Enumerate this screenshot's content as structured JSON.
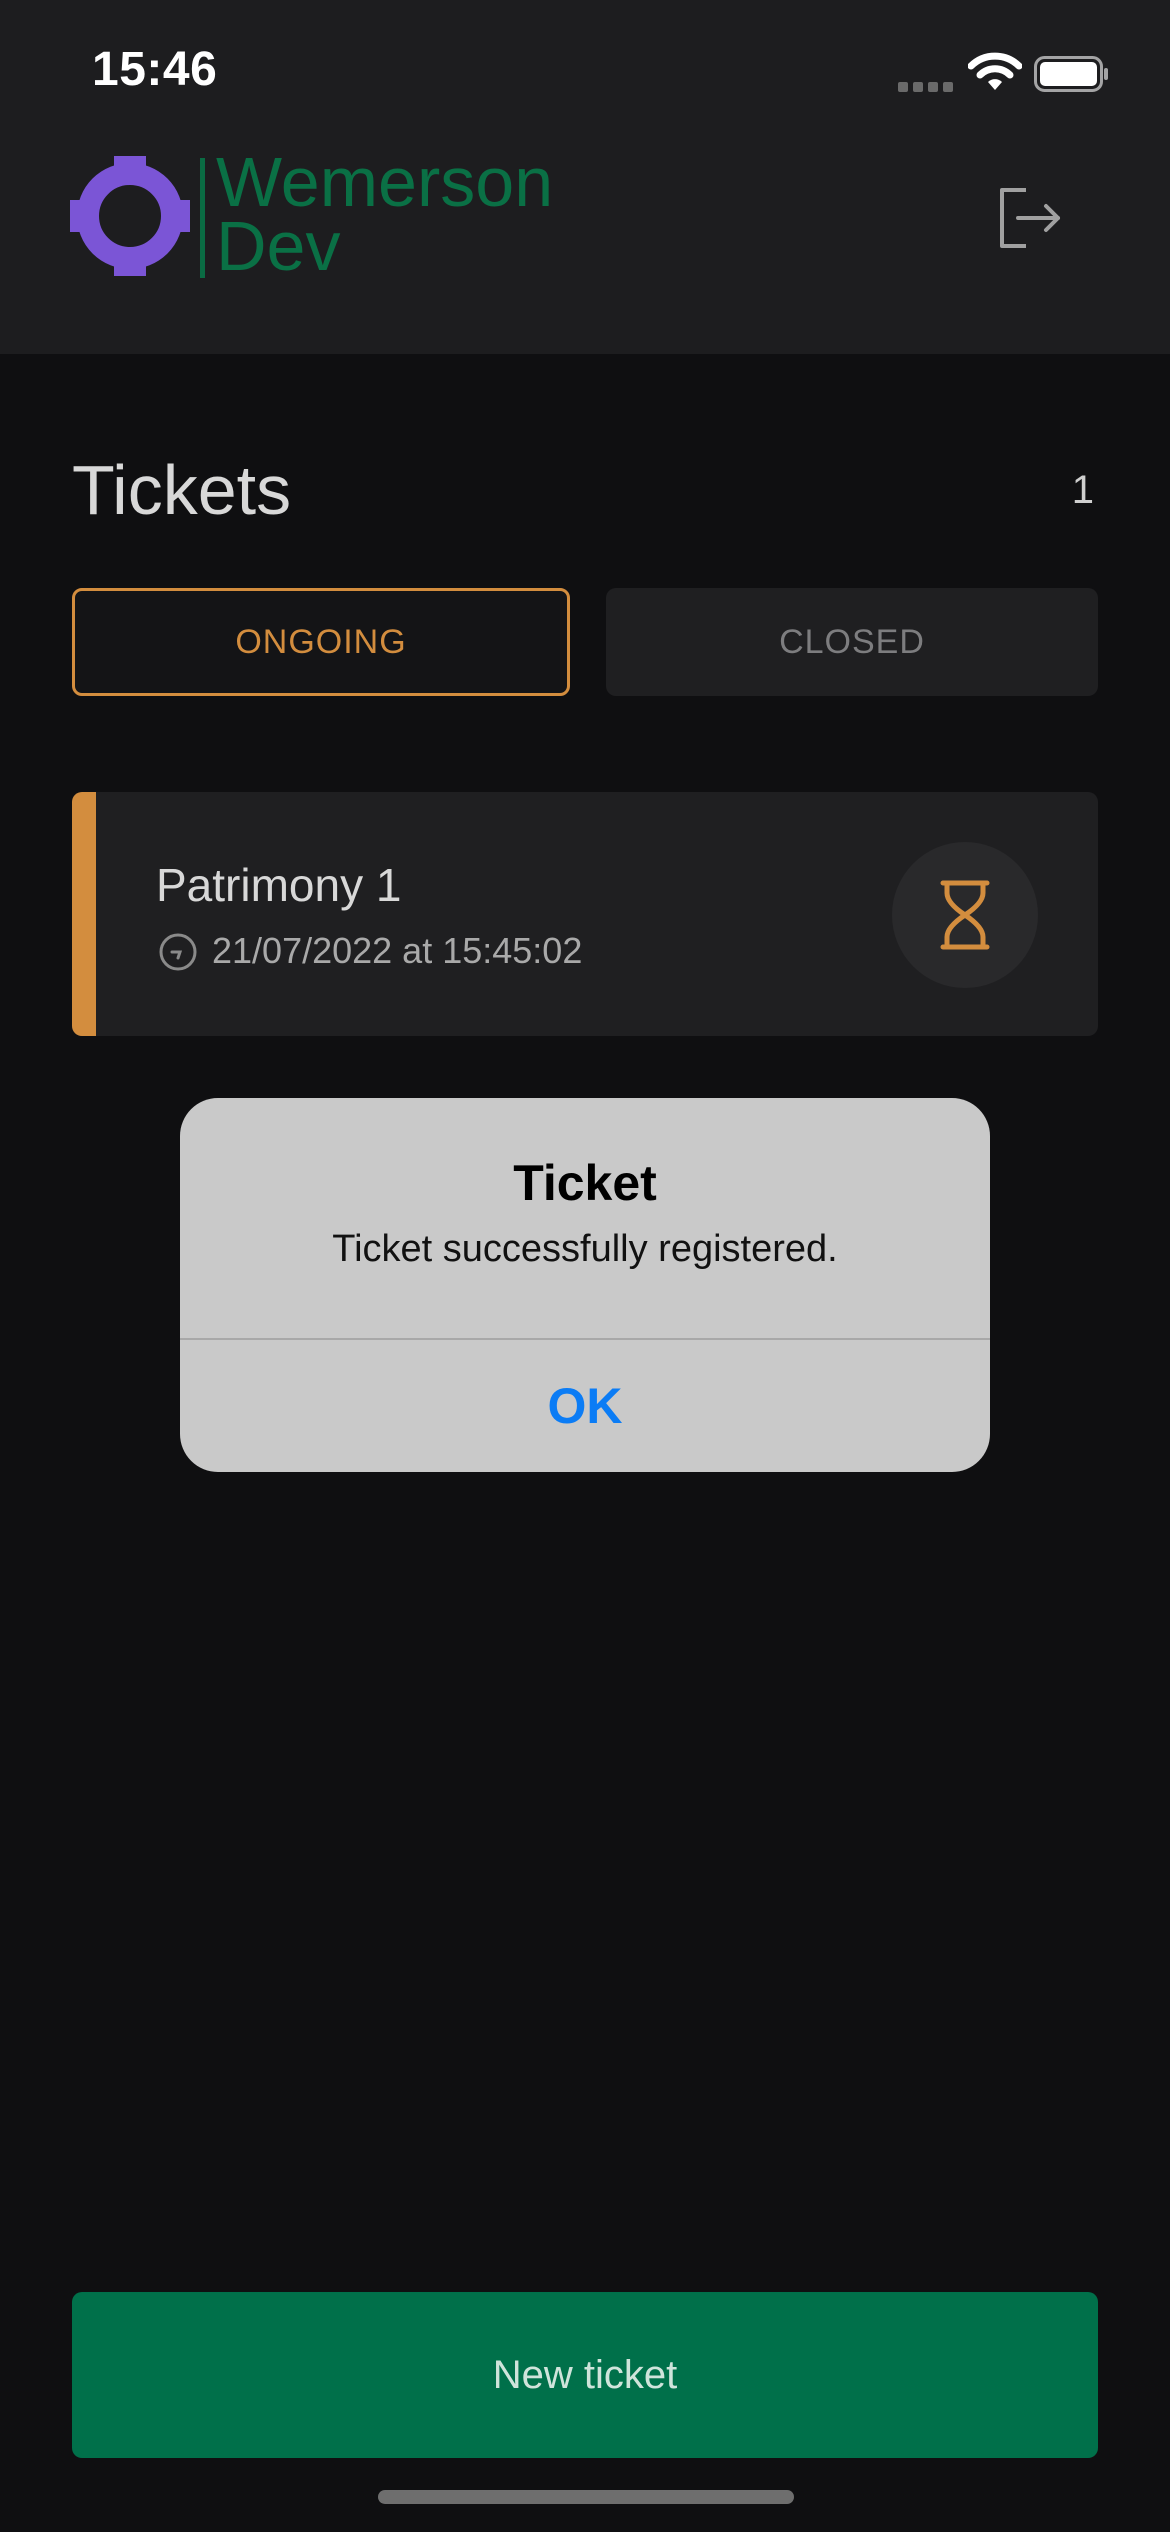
{
  "status_bar": {
    "time": "15:46"
  },
  "header": {
    "logo_text_line1": "Wemerson",
    "logo_text_line2": "Dev",
    "logo_color": "#7b55d6",
    "brand_text_color": "#0a7045"
  },
  "tickets": {
    "title": "Tickets",
    "count": "1",
    "tabs": [
      {
        "label": "ONGOING",
        "selected": true
      },
      {
        "label": "CLOSED",
        "selected": false
      }
    ],
    "items": [
      {
        "title": "Patrimony 1",
        "datetime": "21/07/2022 at 15:45:02",
        "status_icon": "hourglass-icon",
        "accent_color": "#d38d3e"
      }
    ]
  },
  "alert": {
    "title": "Ticket",
    "message": "Ticket successfully registered.",
    "ok_label": "OK"
  },
  "footer": {
    "new_ticket_label": "New ticket",
    "button_color": "#00704a"
  },
  "icons": [
    "wifi-icon",
    "battery-icon",
    "signal-icon",
    "logo-icon",
    "logout-icon",
    "clock-icon",
    "hourglass-icon"
  ]
}
